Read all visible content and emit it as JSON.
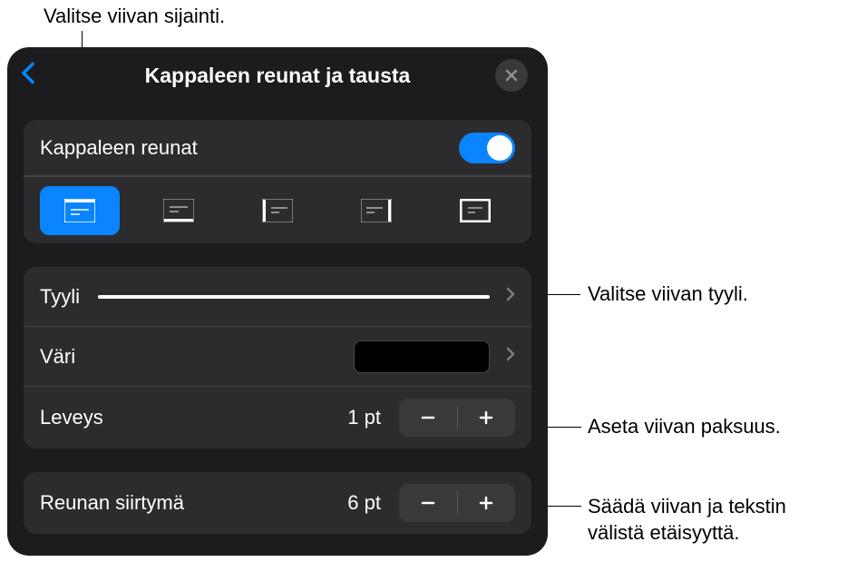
{
  "callouts": {
    "position": "Valitse viivan sijainti.",
    "style": "Valitse viivan tyyli.",
    "thickness": "Aseta viivan paksuus.",
    "offset": "Säädä viivan ja tekstin\nvälistä etäisyyttä."
  },
  "panel": {
    "title": "Kappaleen reunat ja tausta"
  },
  "rows": {
    "borders_label": "Kappaleen reunat",
    "style_label": "Tyyli",
    "color_label": "Väri",
    "width_label": "Leveys",
    "width_value": "1 pt",
    "offset_label": "Reunan siirtymä",
    "offset_value": "6 pt"
  }
}
